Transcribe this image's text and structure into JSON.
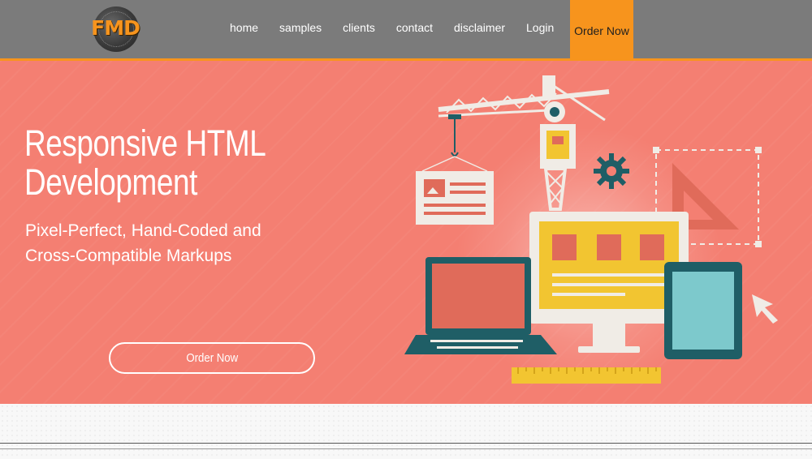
{
  "header": {
    "logo_text": "FMD",
    "nav": {
      "home": "home",
      "samples": "samples",
      "clients": "clients",
      "contact": "contact",
      "disclaimer": "disclaimer",
      "login": "Login"
    },
    "order_label": "Order Now"
  },
  "hero": {
    "title_line1": "Responsive HTML",
    "title_line2": "Development",
    "subtitle_line1": "Pixel-Perfect, Hand-Coded and",
    "subtitle_line2": "Cross-Compatible Markups",
    "cta_label": "Order Now"
  },
  "colors": {
    "header_bg": "#7b7b7b",
    "accent": "#f7941d",
    "hero_bg": "#f47f72",
    "teal_dark": "#1f5e66",
    "teal_light": "#7dc9cc",
    "yellow": "#f2c531",
    "panel": "#f0ece6"
  }
}
